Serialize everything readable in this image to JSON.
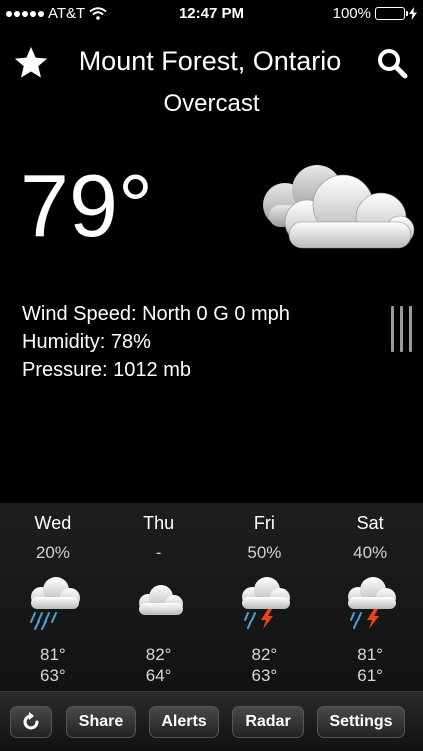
{
  "status_bar": {
    "carrier": "AT&T",
    "time": "12:47 PM",
    "battery": "100%",
    "battery_level": 1.0
  },
  "header": {
    "location": "Mount Forest, Ontario",
    "condition": "Overcast",
    "favorite_icon": "star-icon",
    "search_icon": "search-icon"
  },
  "current": {
    "temperature": "79°",
    "icon": "cloudy-icon",
    "wind": "Wind Speed: North 0 G 0 mph",
    "humidity": "Humidity: 78%",
    "pressure": "Pressure: 1012 mb"
  },
  "forecast": [
    {
      "day": "Wed",
      "precip": "20%",
      "icon": "rain-icon",
      "high": "81°",
      "low": "63°"
    },
    {
      "day": "Thu",
      "precip": "-",
      "icon": "cloudy-icon",
      "high": "82°",
      "low": "64°"
    },
    {
      "day": "Fri",
      "precip": "50%",
      "icon": "thunderstorm-icon",
      "high": "82°",
      "low": "63°"
    },
    {
      "day": "Sat",
      "precip": "40%",
      "icon": "thunderstorm-icon",
      "high": "81°",
      "low": "61°"
    }
  ],
  "toolbar": {
    "refresh_icon": "refresh-icon",
    "share": "Share",
    "alerts": "Alerts",
    "radar": "Radar",
    "settings": "Settings"
  },
  "colors": {
    "background": "#000000",
    "battery_fill": "#4cd964",
    "bolt": "#e8451f",
    "rain": "#4aa3d8"
  }
}
